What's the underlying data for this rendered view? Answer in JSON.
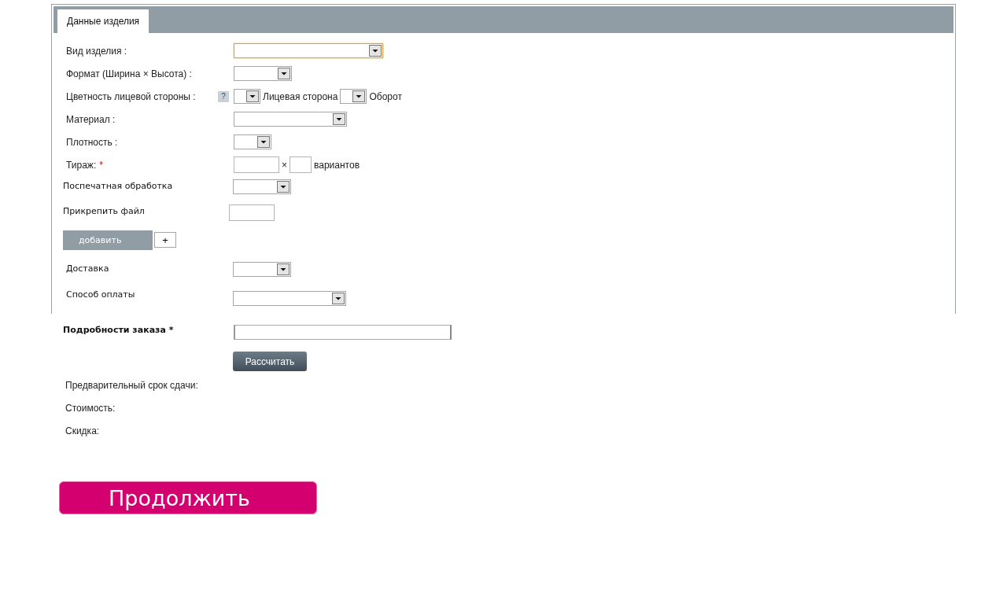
{
  "tabs": [
    {
      "label": "Данные изделия",
      "selected": true
    }
  ],
  "product_fields": [
    {
      "kind": "select",
      "label": "Вид изделия :",
      "focused": true
    },
    {
      "kind": "select",
      "label": "Формат (Ширина × Высота) :",
      "focused": false
    },
    {
      "kind": "color",
      "label": "Цветность лицевой стороны :",
      "help": "?",
      "front_label": "Лицевая сторона",
      "back_label": "Оборот"
    },
    {
      "kind": "select",
      "label": "Материал :",
      "focused": false
    },
    {
      "kind": "select",
      "label": "Плотность :",
      "focused": false
    },
    {
      "kind": "quantity",
      "label": "Тираж:",
      "required_mark": "*",
      "separator": "×",
      "suffix": "вариантов"
    }
  ],
  "post_processing": {
    "label": "Поспечатная обработка"
  },
  "attach_file": {
    "label": "Прикрепить файл"
  },
  "add_button": "добавить",
  "plus_button": "+",
  "delivery": {
    "label": "Доставка"
  },
  "payment": {
    "label": "Способ оплаты"
  },
  "order_details": {
    "label": "Подробности заказа *"
  },
  "calculate_button": "Рассчитать",
  "results": [
    "Предварительный срок сдачи:",
    "Стоимость:",
    "Скидка:"
  ],
  "continue_button": "Продолжить"
}
